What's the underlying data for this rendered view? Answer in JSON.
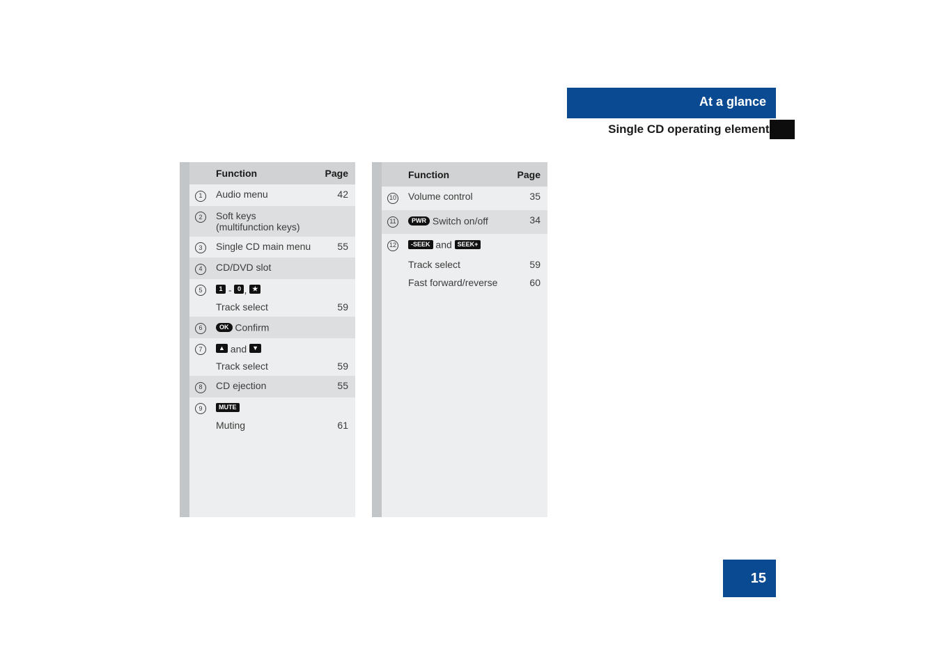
{
  "header": {
    "category": "At a glance",
    "section": "Single CD operating elements"
  },
  "page_number": "15",
  "tables": {
    "left": {
      "columns": {
        "function": "Function",
        "page": "Page"
      },
      "rows": [
        {
          "num": "1",
          "func": "Audio menu",
          "page": "42",
          "shade": "light"
        },
        {
          "num": "2",
          "func": "Soft keys\n(multifunction keys)",
          "page": "",
          "shade": "dark"
        },
        {
          "num": "3",
          "func": "Single CD main menu",
          "page": "55",
          "shade": "light"
        },
        {
          "num": "4",
          "func": "CD/DVD slot",
          "page": "",
          "shade": "dark"
        },
        {
          "num": "5",
          "func_keys": {
            "type": "numrange"
          },
          "page": "",
          "shade": "light"
        },
        {
          "num": "",
          "func": "Track select",
          "page": "59",
          "shade": "light",
          "sub": true
        },
        {
          "num": "6",
          "func_keys": {
            "type": "ok",
            "trail": " Confirm"
          },
          "page": "",
          "shade": "dark"
        },
        {
          "num": "7",
          "func_keys": {
            "type": "updown"
          },
          "page": "",
          "shade": "light"
        },
        {
          "num": "",
          "func": "Track select",
          "page": "59",
          "shade": "light",
          "sub": true
        },
        {
          "num": "8",
          "func": "CD ejection",
          "page": "55",
          "shade": "dark"
        },
        {
          "num": "9",
          "func_keys": {
            "type": "mute"
          },
          "page": "",
          "shade": "light"
        },
        {
          "num": "",
          "func": "Muting",
          "page": "61",
          "shade": "light",
          "sub": true
        }
      ]
    },
    "right": {
      "columns": {
        "function": "Function",
        "page": "Page"
      },
      "rows": [
        {
          "num": "10",
          "func": "Volume control",
          "page": "35",
          "shade": "light"
        },
        {
          "num": "11",
          "func_keys": {
            "type": "pwr",
            "trail": " Switch on/off"
          },
          "page": "34",
          "shade": "dark"
        },
        {
          "num": "12",
          "func_keys": {
            "type": "seek"
          },
          "page": "",
          "shade": "light"
        },
        {
          "num": "",
          "func": "Track select",
          "page": "59",
          "shade": "light",
          "sub": true
        },
        {
          "num": "",
          "func": "Fast forward/reverse",
          "page": "60",
          "shade": "light",
          "sub": true
        }
      ]
    }
  },
  "key_labels": {
    "one": "1",
    "zero": "0",
    "ok": "OK",
    "mute": "MUTE",
    "pwr": "PWR",
    "seek_minus": "-SEEK",
    "seek_plus": "SEEK+",
    "dash": " - ",
    "comma": ", ",
    "and": " and "
  }
}
